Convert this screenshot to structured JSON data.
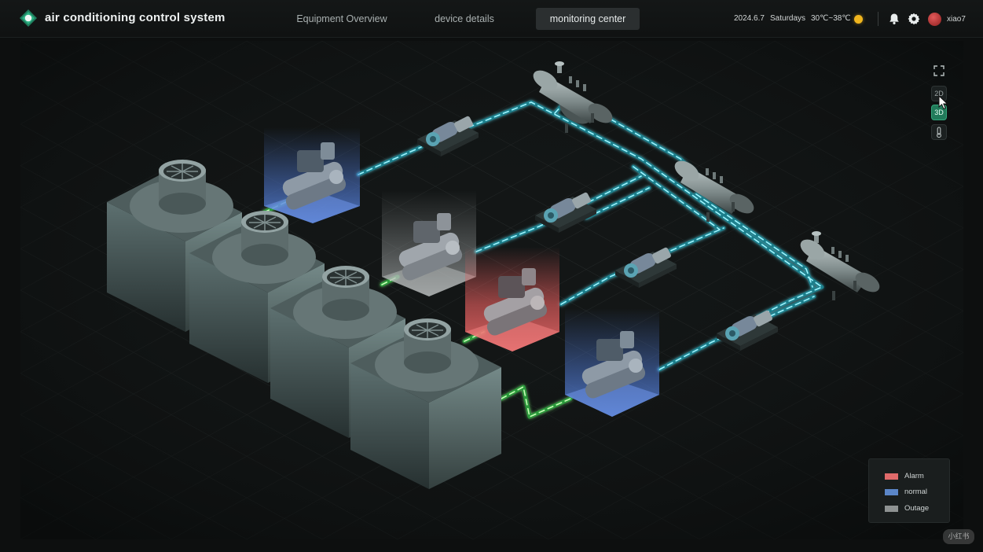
{
  "header": {
    "title": "air conditioning control system",
    "tabs": [
      {
        "label": "Equipment Overview",
        "active": false
      },
      {
        "label": "device details",
        "active": false
      },
      {
        "label": "monitoring center",
        "active": true
      }
    ],
    "date": "2024.6.7",
    "weekday": "Saturdays",
    "temperature": "30℃~38℃",
    "weather_icon": "sun-icon",
    "user": "xiao7"
  },
  "toolbar": {
    "fullscreen_icon": "fullscreen-icon",
    "view_2d": "2D",
    "view_3d": "3D",
    "active_view": "3D",
    "thermometer_icon": "thermometer-icon"
  },
  "legend": [
    {
      "label": "Alarm",
      "color": "#e06a6a"
    },
    {
      "label": "normal",
      "color": "#5b86c8"
    },
    {
      "label": "Outage",
      "color": "#8e9292"
    }
  ],
  "colors": {
    "accent": "#2faa7c",
    "pipe_cyan": "#3fd0e0",
    "pipe_green": "#56e06a",
    "alarm": "#e05c5c",
    "normal": "#4f78d0",
    "outage": "#8e9292"
  },
  "watermark": "小红书"
}
